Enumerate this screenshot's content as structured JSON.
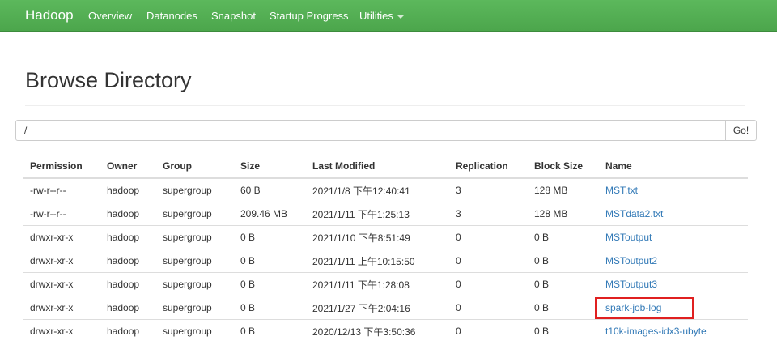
{
  "navbar": {
    "brand": "Hadoop",
    "items": [
      {
        "label": "Overview"
      },
      {
        "label": "Datanodes"
      },
      {
        "label": "Snapshot"
      },
      {
        "label": "Startup Progress"
      },
      {
        "label": "Utilities"
      }
    ],
    "background": "#5cb85c"
  },
  "page": {
    "title": "Browse Directory"
  },
  "path_bar": {
    "value": "/",
    "go_label": "Go!"
  },
  "table": {
    "columns": [
      "Permission",
      "Owner",
      "Group",
      "Size",
      "Last Modified",
      "Replication",
      "Block Size",
      "Name"
    ],
    "rows": [
      {
        "permission": "-rw-r--r--",
        "owner": "hadoop",
        "group": "supergroup",
        "size": "60 B",
        "last_modified": "2021/1/8 下午12:40:41",
        "replication": "3",
        "block_size": "128 MB",
        "name": "MST.txt"
      },
      {
        "permission": "-rw-r--r--",
        "owner": "hadoop",
        "group": "supergroup",
        "size": "209.46 MB",
        "last_modified": "2021/1/11 下午1:25:13",
        "replication": "3",
        "block_size": "128 MB",
        "name": "MSTdata2.txt"
      },
      {
        "permission": "drwxr-xr-x",
        "owner": "hadoop",
        "group": "supergroup",
        "size": "0 B",
        "last_modified": "2021/1/10 下午8:51:49",
        "replication": "0",
        "block_size": "0 B",
        "name": "MSToutput"
      },
      {
        "permission": "drwxr-xr-x",
        "owner": "hadoop",
        "group": "supergroup",
        "size": "0 B",
        "last_modified": "2021/1/11 上午10:15:50",
        "replication": "0",
        "block_size": "0 B",
        "name": "MSToutput2"
      },
      {
        "permission": "drwxr-xr-x",
        "owner": "hadoop",
        "group": "supergroup",
        "size": "0 B",
        "last_modified": "2021/1/11 下午1:28:08",
        "replication": "0",
        "block_size": "0 B",
        "name": "MSToutput3"
      },
      {
        "permission": "drwxr-xr-x",
        "owner": "hadoop",
        "group": "supergroup",
        "size": "0 B",
        "last_modified": "2021/1/27 下午2:04:16",
        "replication": "0",
        "block_size": "0 B",
        "name": "spark-job-log"
      },
      {
        "permission": "drwxr-xr-x",
        "owner": "hadoop",
        "group": "supergroup",
        "size": "0 B",
        "last_modified": "2020/12/13 下午3:50:36",
        "replication": "0",
        "block_size": "0 B",
        "name": "t10k-images-idx3-ubyte"
      }
    ]
  },
  "annotation": {
    "highlight_color": "#e02020"
  },
  "colors": {
    "link": "#337ab7",
    "navbar": "#5cb85c"
  }
}
